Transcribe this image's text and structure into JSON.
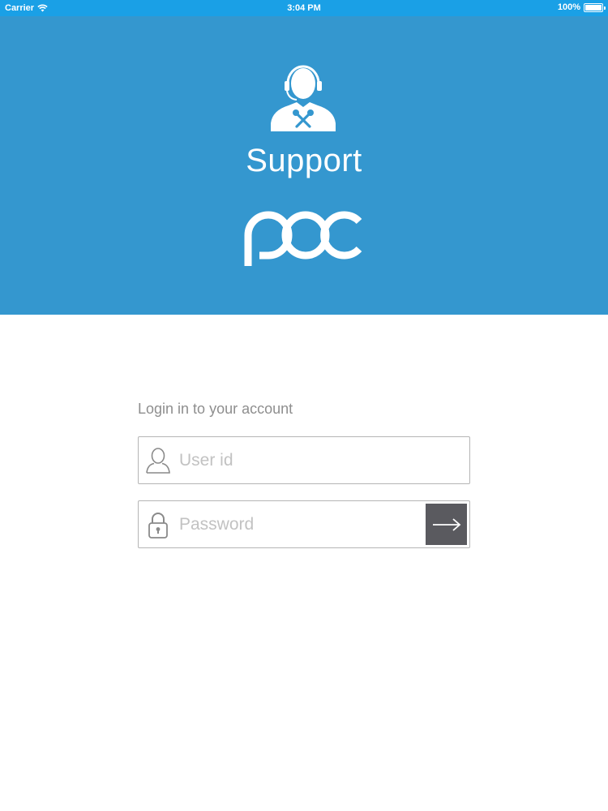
{
  "status_bar": {
    "carrier": "Carrier",
    "time": "3:04 PM",
    "battery": "100%"
  },
  "hero": {
    "title": "Support",
    "background": "#3497cf",
    "logo_icon": "poc-logo",
    "support_icon": "support-agent-icon"
  },
  "login": {
    "heading": "Login in to your account",
    "user_placeholder": "User id",
    "password_placeholder": "Password",
    "submit_icon": "arrow-right-icon"
  },
  "colors": {
    "status_bar": "#1aa0e6",
    "hero": "#3497cf",
    "button": "#5a5a5f"
  }
}
